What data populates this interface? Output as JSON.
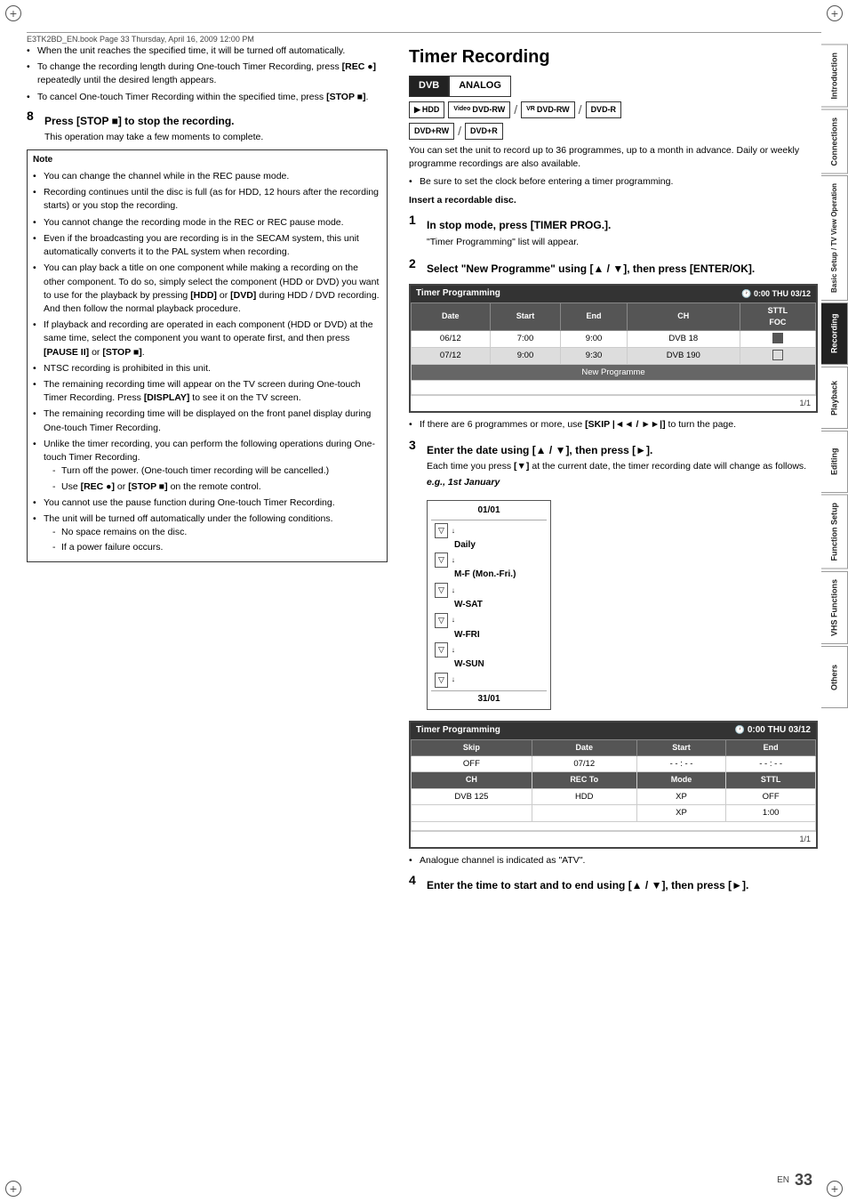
{
  "page": {
    "file_info": "E3TK2BD_EN.book  Page 33  Thursday, April 16, 2009  12:00 PM",
    "page_number": "33",
    "page_en": "EN"
  },
  "sidebar": {
    "tabs": [
      {
        "id": "introduction",
        "label": "Introduction",
        "active": false
      },
      {
        "id": "connections",
        "label": "Connections",
        "active": false
      },
      {
        "id": "basic-setup",
        "label": "Basic Setup / TV View Operation",
        "active": false
      },
      {
        "id": "recording",
        "label": "Recording",
        "active": true
      },
      {
        "id": "playback",
        "label": "Playback",
        "active": false
      },
      {
        "id": "editing",
        "label": "Editing",
        "active": false
      },
      {
        "id": "function-setup",
        "label": "Function Setup",
        "active": false
      },
      {
        "id": "vhs-functions",
        "label": "VHS Functions",
        "active": false
      },
      {
        "id": "others",
        "label": "Others",
        "active": false
      }
    ]
  },
  "left_column": {
    "bullets": [
      "When the unit reaches the specified time, it will be turned off automatically.",
      "To change the recording length during One-touch Timer Recording, press [REC ●] repeatedly until the desired length appears.",
      "To cancel One-touch Timer Recording within the specified time, press [STOP ■]."
    ],
    "step8": {
      "num": "8",
      "heading": "Press [STOP ■] to stop the recording.",
      "sub": "This operation may take a few moments to complete."
    },
    "note": {
      "title": "Note",
      "items": [
        "You can change the channel while in the REC pause mode.",
        "Recording continues until the disc is full (as for HDD, 12 hours after the recording starts) or you stop the recording.",
        "You cannot change the recording mode in the REC or REC pause mode.",
        "Even if the broadcasting you are recording is in the SECAM system, this unit automatically converts it to the PAL system when recording.",
        "You can play back a title on one component while making a recording on the other component. To do so, simply select the component (HDD or DVD) you want to use for the playback by pressing [HDD] or [DVD] during HDD / DVD recording. And then follow the normal playback procedure.",
        "If playback and recording are operated in each component (HDD or DVD) at the same time, select the component you want to operate first, and then press [PAUSE II] or [STOP ■].",
        "NTSC recording is prohibited in this unit.",
        "The remaining recording time will appear on the TV screen during One-touch Timer Recording. Press [DISPLAY] to see it on the TV screen.",
        "The remaining recording time will be displayed on the front panel display during One-touch Timer Recording.",
        "Unlike the timer recording, you can perform the following operations during One-touch Timer Recording.",
        "You cannot use the pause function during One-touch Timer Recording.",
        "The unit will be turned off automatically under the following conditions."
      ],
      "sub_items": [
        "Turn off the power. (One-touch timer recording will be cancelled.)",
        "Use [REC ●] or [STOP ■] on the remote control.",
        "No space remains on the disc.",
        "If a power failure occurs."
      ]
    }
  },
  "right_column": {
    "title": "Timer Recording",
    "device_buttons": [
      {
        "label": "DVB",
        "active": true
      },
      {
        "label": "ANALOG",
        "active": false
      }
    ],
    "disc_icons": [
      {
        "label": "HDD",
        "prefix": "▶"
      },
      {
        "label": "DVD-RW",
        "sup": "Video",
        "slash": true
      },
      {
        "label": "DVD-RW",
        "sup": "VR",
        "slash": true
      },
      {
        "label": "DVD-R",
        "slash": false
      }
    ],
    "disc_icons2": [
      {
        "label": "DVD+RW",
        "slash": true
      },
      {
        "label": "DVD+R",
        "slash": false
      }
    ],
    "intro_text": "You can set the unit to record up to 36 programmes, up to a month in advance. Daily or weekly programme recordings are also available.",
    "bullet_note": "Be sure to set the clock before entering a timer programming.",
    "insert_label": "Insert a recordable disc.",
    "step1": {
      "num": "1",
      "heading": "In stop mode, press [TIMER PROG.].",
      "sub": "\"Timer Programming\" list will appear."
    },
    "step2": {
      "num": "2",
      "heading": "Select \"New Programme\" using [▲ / ▼], then press [ENTER/OK]."
    },
    "timer_table1": {
      "header": "Timer Programming",
      "clock": "0:00 THU 03/12",
      "columns": [
        "Date",
        "Start",
        "End",
        "CH",
        "STIL FOC"
      ],
      "rows": [
        {
          "date": "06/12",
          "start": "7:00",
          "end": "9:00",
          "ch": "DVB 18",
          "check": true
        },
        {
          "date": "07/12",
          "start": "9:00",
          "end": "9:30",
          "ch": "DVB 190",
          "check": false
        }
      ],
      "new_programme": "New Programme",
      "footer": "1/1"
    },
    "skip_bullet": "If there are 6 programmes or more, use [SKIP |◄◄ / ►►|] to turn the page.",
    "step3": {
      "num": "3",
      "heading": "Enter the date using [▲ / ▼], then press [►].",
      "sub": "Each time you press [▼] at the current date, the timer recording date will change as follows.",
      "eg": "e.g., 1st January"
    },
    "date_diagram": {
      "top": "01/01",
      "items": [
        {
          "label": "Daily"
        },
        {
          "label": "M-F (Mon.-Fri.)"
        },
        {
          "label": "W-SAT"
        },
        {
          "label": "W-FRI"
        },
        {
          "label": "W-SUN"
        }
      ],
      "bottom": "31/01"
    },
    "timer_table2": {
      "header": "Timer Programming",
      "clock": "0:00 THU 03/12",
      "row1_labels": [
        "Skip",
        "Date",
        "Start",
        "End"
      ],
      "row1_values": [
        "OFF",
        "07/12",
        "- - : - -",
        "- - : - -"
      ],
      "row2_labels": [
        "CH",
        "REC To",
        "Mode",
        "STTL"
      ],
      "row2_values": [
        "DVB 125",
        "HDD",
        "XP",
        "OFF"
      ],
      "row3_values": [
        "",
        "",
        "XP",
        "1:00"
      ],
      "footer": "1/1"
    },
    "analogue_note": "Analogue channel is indicated as \"ATV\".",
    "step4": {
      "num": "4",
      "heading": "Enter the time to start and to end using [▲ / ▼], then press [►]."
    }
  }
}
